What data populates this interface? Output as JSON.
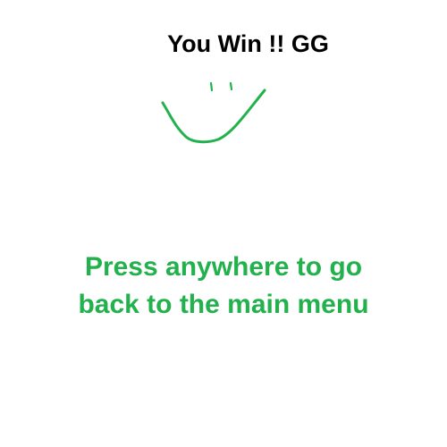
{
  "colors": {
    "background": "#ffffff",
    "title": "#000000",
    "accent_green": "#22b14c"
  },
  "screen": {
    "title": "You Win !! GG",
    "smiley_icon": "hand-drawn-smiley-face",
    "prompt_line1": "Press anywhere to go",
    "prompt_line2": "back to the main menu"
  }
}
